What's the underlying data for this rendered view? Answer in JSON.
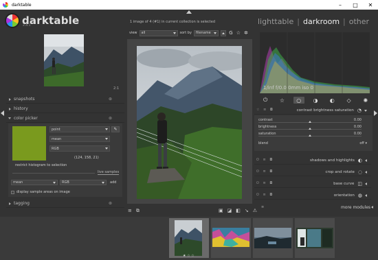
{
  "window": {
    "title": "darktable",
    "buttons": [
      "–",
      "□",
      "✕"
    ]
  },
  "app": {
    "logo_text": "darktable",
    "version": "2.4.1"
  },
  "header": {
    "collection_info": "1 image of 4 (#1) in current collection is selected",
    "view_label": "view",
    "view_value": "all",
    "sort_label": "sort by",
    "sort_value": "filename",
    "views": [
      "lighttable",
      "darkroom",
      "other"
    ],
    "active_view": "darkroom",
    "view_sep": "|"
  },
  "left_panel": {
    "sections": {
      "snapshots": "snapshots",
      "history": "history",
      "color_picker": "color picker",
      "tagging": "tagging"
    },
    "color_picker": {
      "swatch_color": "#7a9a1e",
      "mode": "point",
      "statistic": "mean",
      "colorspace": "RGB",
      "values": "(124, 158, 21)",
      "restrict_label": "restrict histogram to selection",
      "live_samples": "live samples",
      "sample_stat": "mean",
      "sample_space": "RGB",
      "add_label": "add",
      "display_label": "display sample areas on image"
    },
    "zoom_icon": "2:1"
  },
  "histogram": {
    "exif_text": "1/inf f/0.0 0mm iso 0"
  },
  "modules": {
    "contrast": {
      "title": "contrast brightness saturation",
      "sliders": [
        {
          "label": "contrast",
          "value": "0.00",
          "pos": 0.5
        },
        {
          "label": "brightness",
          "value": "0.00",
          "pos": 0.5
        },
        {
          "label": "saturation",
          "value": "0.00",
          "pos": 0.5
        }
      ],
      "blend_label": "blend",
      "blend_value": "off"
    },
    "list": [
      {
        "title": "shadows and highlights",
        "icon": "shadows-icon"
      },
      {
        "title": "crop and rotate",
        "icon": "crop-icon"
      },
      {
        "title": "base curve",
        "icon": "curve-icon"
      },
      {
        "title": "orientation",
        "icon": "orientation-icon"
      }
    ],
    "more_modules": "more modules"
  },
  "filmstrip": {
    "count": 4
  }
}
